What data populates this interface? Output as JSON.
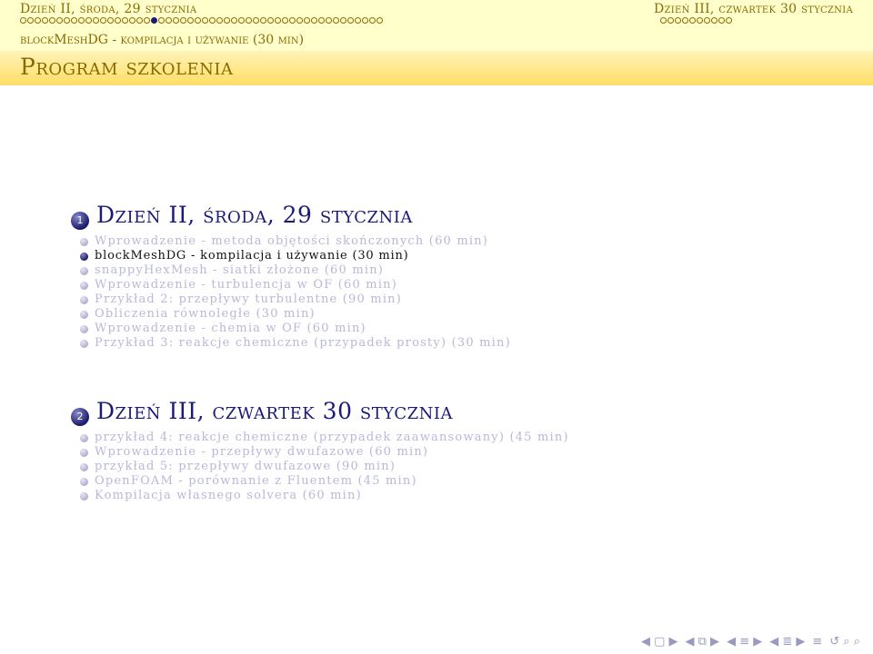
{
  "header": {
    "left_title": "Dzień II, środa, 29 stycznia",
    "right_title": "Dzień III, czwartek 30 stycznia",
    "left_dot_count": 50,
    "left_active_dot": 18,
    "right_dot_count": 10
  },
  "subheader": {
    "text": "blockMeshDG - kompilacja i używanie (30 min)"
  },
  "frame_title": "Program szkolenia",
  "sections": [
    {
      "number": "1",
      "title": "Dzień II, środa, 29 stycznia",
      "items": [
        {
          "text": "Wprowadzenie - metoda objętości skończonych (60 min)",
          "active": false
        },
        {
          "text": "blockMeshDG - kompilacja i używanie (30 min)",
          "active": true
        },
        {
          "text": "snappyHexMesh - siatki złożone (60 min)",
          "active": false
        },
        {
          "text": "Wprowadzenie - turbulencja w OF (60 min)",
          "active": false
        },
        {
          "text": "Przykład 2: przepływy turbulentne (90 min)",
          "active": false
        },
        {
          "text": "Obliczenia równoległe (30 min)",
          "active": false
        },
        {
          "text": "Wprowadzenie - chemia w OF (60 min)",
          "active": false
        },
        {
          "text": "Przykład 3: reakcje chemiczne (przypadek prosty) (30 min)",
          "active": false
        }
      ]
    },
    {
      "number": "2",
      "title": "Dzień III, czwartek 30 stycznia",
      "items": [
        {
          "text": "przykład 4: reakcje chemiczne (przypadek zaawansowany) (45 min)",
          "active": false
        },
        {
          "text": "Wprowadzenie - przepływy dwufazowe (60 min)",
          "active": false
        },
        {
          "text": "przykład 5: przepływy dwufazowe (90 min)",
          "active": false
        },
        {
          "text": "OpenFOAM - porównanie z Fluentem (45 min)",
          "active": false
        },
        {
          "text": "Kompilacja własnego solvera (60 min)",
          "active": false
        }
      ]
    }
  ],
  "nav": {
    "icons": [
      "◀ ▢ ▶",
      "◀ ⧉ ▶",
      "◀ ≡ ▶",
      "◀ ≣ ▶",
      "≡",
      "↺ ⌕ ⌕"
    ]
  }
}
